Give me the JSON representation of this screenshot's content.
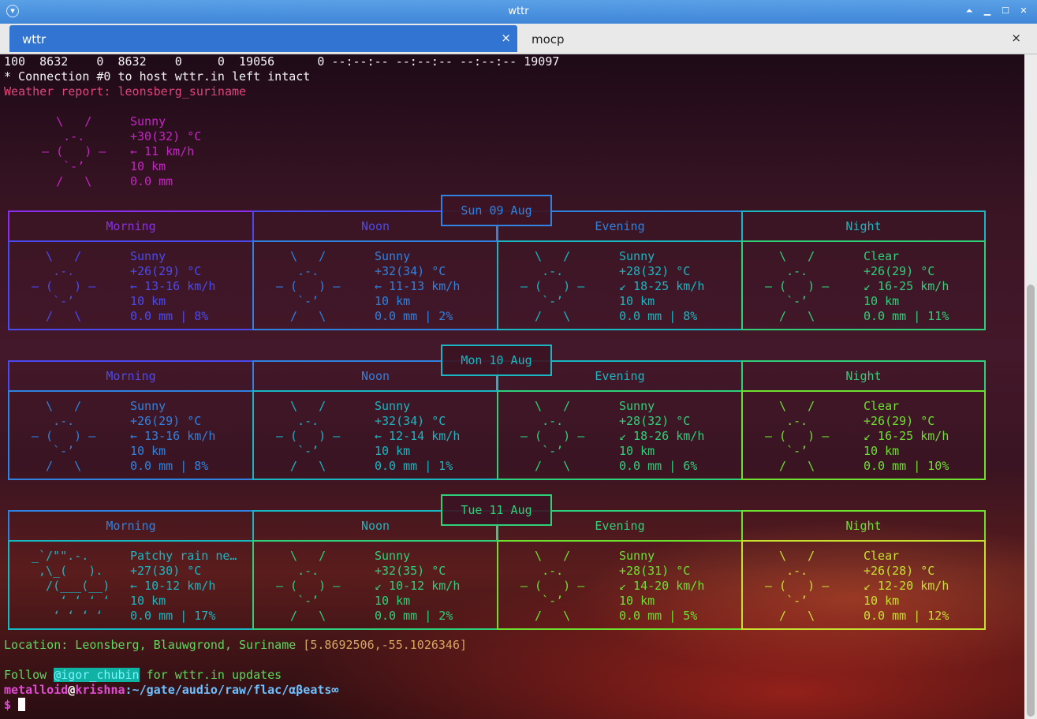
{
  "window": {
    "title": "wttr"
  },
  "tabs": [
    {
      "label": "wttr",
      "close": "×"
    },
    {
      "label": "mocp",
      "close": "×"
    }
  ],
  "terminal": {
    "curl_line": "100  8632    0  8632    0     0  19056      0 --:--:-- --:--:-- --:--:-- 19097",
    "connection_line": "* Connection #0 to host wttr.in left intact",
    "report_line": "Weather report: leonsberg_suriname",
    "current": {
      "art": [
        "    \\   /",
        "     .-.",
        "  ― (   ) ―",
        "     `-’",
        "    /   \\"
      ],
      "info": [
        "Sunny",
        "+30(32) °C",
        "← 11 km/h",
        "10 km",
        "0.0 mm"
      ]
    },
    "location_line": "Location: Leonsberg, Blauwgrond, Suriname [5.8692506,-55.1026346]",
    "follow_prefix": "Follow ",
    "follow_handle": "@igor_chubin",
    "follow_suffix": " for wttr.in updates",
    "prompt_user": "metalloid",
    "prompt_at": "@",
    "prompt_host": "krishna",
    "prompt_path": ":~/gate/audio/raw/flac/αβeats∞",
    "prompt_symbol": "$ "
  },
  "forecast": [
    {
      "date": "Sun 09 Aug",
      "periods": [
        {
          "name": "Morning",
          "art": [
            "  \\   /",
            "   .-.",
            "― (   ) ―",
            "   `-’",
            "  /   \\"
          ],
          "cond": "Sunny",
          "temp": "+26(29) °C",
          "wind": "← 13-16 km/h",
          "vis": "10 km",
          "rain": "0.0 mm | 8%"
        },
        {
          "name": "Noon",
          "art": [
            "  \\   /",
            "   .-.",
            "― (   ) ―",
            "   `-’",
            "  /   \\"
          ],
          "cond": "Sunny",
          "temp": "+32(34) °C",
          "wind": "← 11-13 km/h",
          "vis": "10 km",
          "rain": "0.0 mm | 2%"
        },
        {
          "name": "Evening",
          "art": [
            "  \\   /",
            "   .-.",
            "― (   ) ―",
            "   `-’",
            "  /   \\"
          ],
          "cond": "Sunny",
          "temp": "+28(32) °C",
          "wind": "↙ 18-25 km/h",
          "vis": "10 km",
          "rain": "0.0 mm | 8%"
        },
        {
          "name": "Night",
          "art": [
            "  \\   /",
            "   .-.",
            "― (   ) ―",
            "   `-’",
            "  /   \\"
          ],
          "cond": "Clear",
          "temp": "+26(29) °C",
          "wind": "↙ 16-25 km/h",
          "vis": "10 km",
          "rain": "0.0 mm | 11%"
        }
      ]
    },
    {
      "date": "Mon 10 Aug",
      "periods": [
        {
          "name": "Morning",
          "art": [
            "  \\   /",
            "   .-.",
            "― (   ) ―",
            "   `-’",
            "  /   \\"
          ],
          "cond": "Sunny",
          "temp": "+26(29) °C",
          "wind": "← 13-16 km/h",
          "vis": "10 km",
          "rain": "0.0 mm | 8%"
        },
        {
          "name": "Noon",
          "art": [
            "  \\   /",
            "   .-.",
            "― (   ) ―",
            "   `-’",
            "  /   \\"
          ],
          "cond": "Sunny",
          "temp": "+32(34) °C",
          "wind": "← 12-14 km/h",
          "vis": "10 km",
          "rain": "0.0 mm | 1%"
        },
        {
          "name": "Evening",
          "art": [
            "  \\   /",
            "   .-.",
            "― (   ) ―",
            "   `-’",
            "  /   \\"
          ],
          "cond": "Sunny",
          "temp": "+28(32) °C",
          "wind": "↙ 18-26 km/h",
          "vis": "10 km",
          "rain": "0.0 mm | 6%"
        },
        {
          "name": "Night",
          "art": [
            "  \\   /",
            "   .-.",
            "― (   ) ―",
            "   `-’",
            "  /   \\"
          ],
          "cond": "Clear",
          "temp": "+26(29) °C",
          "wind": "↙ 16-25 km/h",
          "vis": "10 km",
          "rain": "0.0 mm | 10%"
        }
      ]
    },
    {
      "date": "Tue 11 Aug",
      "periods": [
        {
          "name": "Morning",
          "art": [
            "_`/\"\".-.",
            " ,\\_(   ).",
            "  /(___(__)",
            "    ‘ ‘ ‘ ‘",
            "   ‘ ‘ ‘ ‘"
          ],
          "cond": "Patchy rain ne…",
          "temp": "+27(30) °C",
          "wind": "← 10-12 km/h",
          "vis": "10 km",
          "rain": "0.0 mm | 17%"
        },
        {
          "name": "Noon",
          "art": [
            "  \\   /",
            "   .-.",
            "― (   ) ―",
            "   `-’",
            "  /   \\"
          ],
          "cond": "Sunny",
          "temp": "+32(35) °C",
          "wind": "↙ 10-12 km/h",
          "vis": "10 km",
          "rain": "0.0 mm | 2%"
        },
        {
          "name": "Evening",
          "art": [
            "  \\   /",
            "   .-.",
            "― (   ) ―",
            "   `-’",
            "  /   \\"
          ],
          "cond": "Sunny",
          "temp": "+28(31) °C",
          "wind": "↙ 14-20 km/h",
          "vis": "10 km",
          "rain": "0.0 mm | 5%"
        },
        {
          "name": "Night",
          "art": [
            "  \\   /",
            "   .-.",
            "― (   ) ―",
            "   `-’",
            "  /   \\"
          ],
          "cond": "Clear",
          "temp": "+26(28) °C",
          "wind": "↙ 12-20 km/h",
          "vis": "10 km",
          "rain": "0.0 mm | 12%"
        }
      ]
    }
  ],
  "colors": {
    "report": "#e0457a",
    "current": "#c425c4",
    "location": "#5fd75f",
    "location_coords": "#d7a65f",
    "follow": "#5fd75f",
    "rainbow": [
      "#8a2ff0",
      "#4a4af0",
      "#2f82e0",
      "#19b7c2",
      "#2fd07a",
      "#6ee02f",
      "#c8e02f",
      "#f0a02f",
      "#f0503a",
      "#e02f9a",
      "#b02fe0"
    ]
  }
}
